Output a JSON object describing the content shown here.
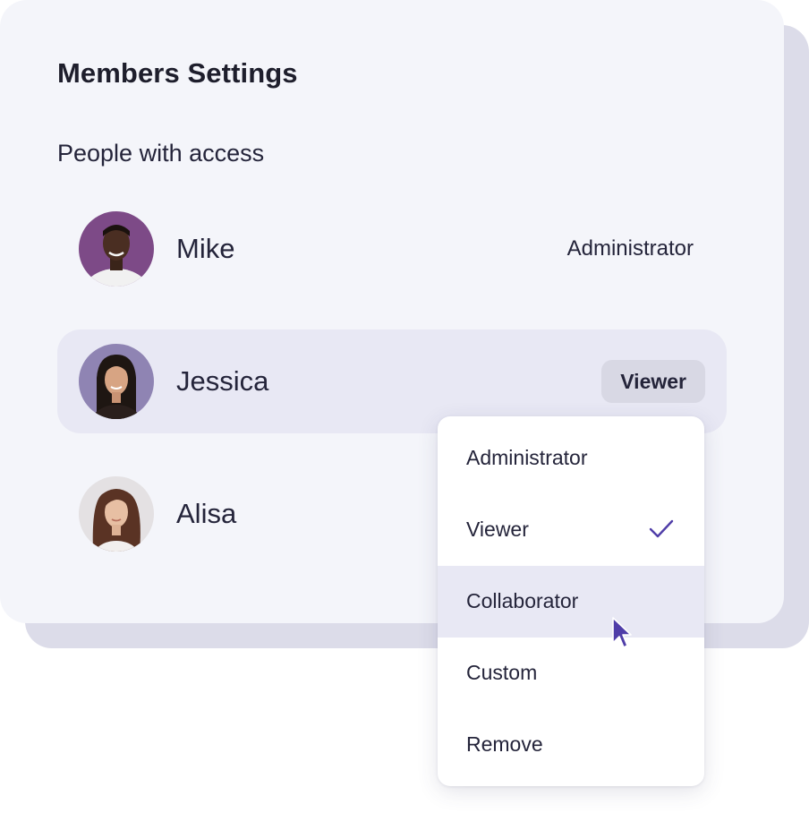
{
  "header": {
    "title": "Members Settings",
    "subtitle": "People with access"
  },
  "members": [
    {
      "name": "Mike",
      "role": "Administrator",
      "avatar": "person-avatar"
    },
    {
      "name": "Jessica",
      "role": "Viewer",
      "avatar": "person-avatar",
      "selected": true
    },
    {
      "name": "Alisa",
      "role": "",
      "avatar": "person-avatar"
    }
  ],
  "role_menu": {
    "items": [
      {
        "label": "Administrator"
      },
      {
        "label": "Viewer",
        "checked": true,
        "icon": "check-icon"
      },
      {
        "label": "Collaborator",
        "hovered": true
      },
      {
        "label": "Custom"
      },
      {
        "label": "Remove"
      }
    ]
  },
  "colors": {
    "accent": "#4f3da8",
    "card": "#f4f5fa",
    "card_shadow": "#dcdce9",
    "selected_row": "#e8e8f4",
    "pill": "#d8d8e4"
  }
}
